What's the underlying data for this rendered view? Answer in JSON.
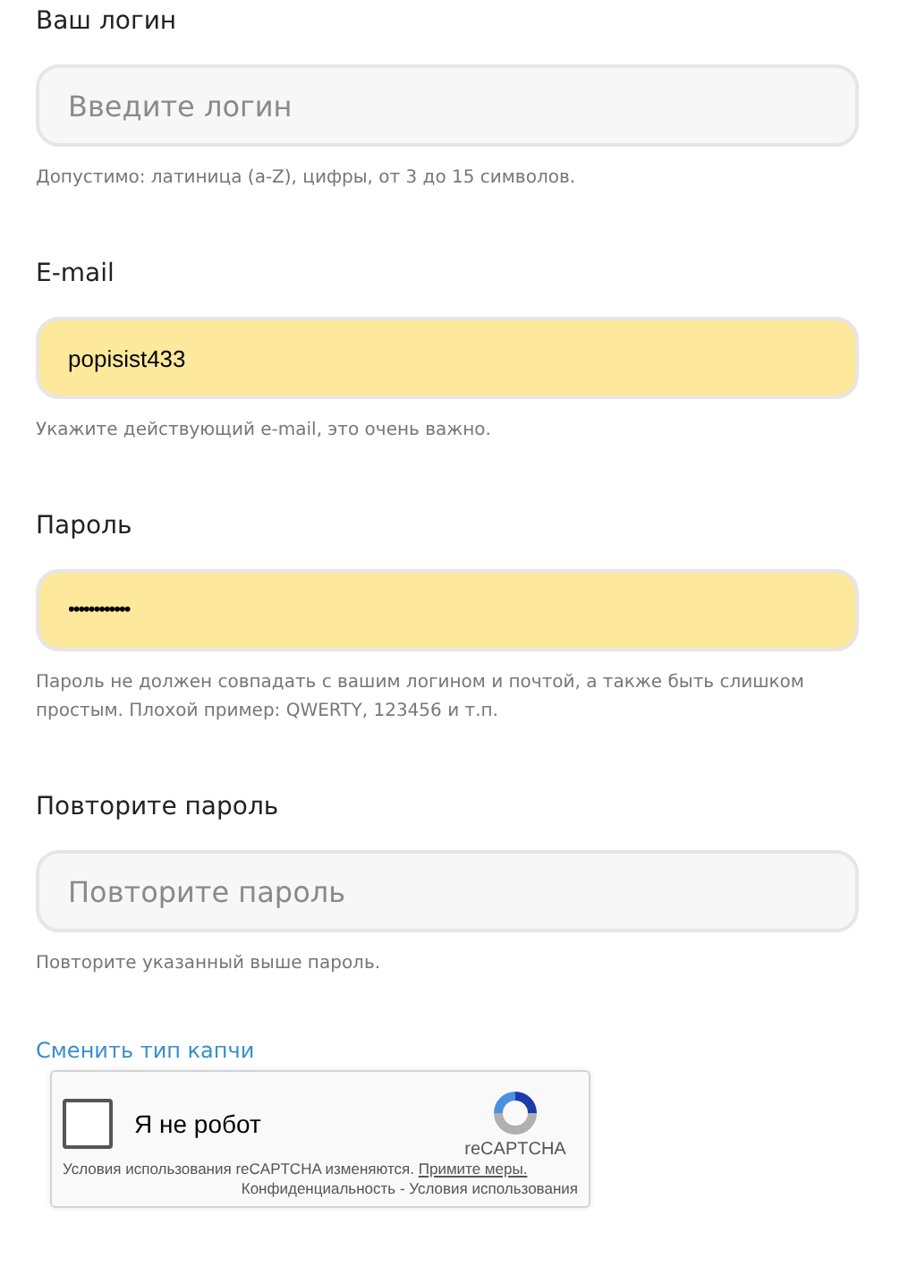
{
  "fields": [
    {
      "label": "Ваш логин",
      "kind": "text",
      "placeholder": "Введите логин",
      "autofilled": false,
      "hint": "Допустимо: латиница (a-Z), цифры, от 3 до 15 символов."
    },
    {
      "label": "E-mail",
      "kind": "text",
      "value": "popisist433",
      "autofilled": true,
      "hint": "Укажите действующий e-mail, это очень важно."
    },
    {
      "label": "Пароль",
      "kind": "password",
      "value": "••••••••••••",
      "autofilled": true,
      "hint": "Пароль не должен совпадать с вашим логином и почтой, а также быть слишком простым. Плохой пример: QWERTY, 123456 и т.п."
    },
    {
      "label": "Повторите пароль",
      "kind": "password",
      "placeholder": "Повторите пароль",
      "autofilled": false,
      "hint": "Повторите указанный выше пароль."
    }
  ],
  "captcha_switch_link": "Сменить тип капчи",
  "captcha": {
    "label": "Я не робот",
    "checked": false,
    "brand": "reCAPTCHA",
    "notice": "Условия использования reCAPTCHA изменяются.",
    "notice_link": "Примите меры.",
    "footer": "Конфиденциальность - Условия использования"
  }
}
